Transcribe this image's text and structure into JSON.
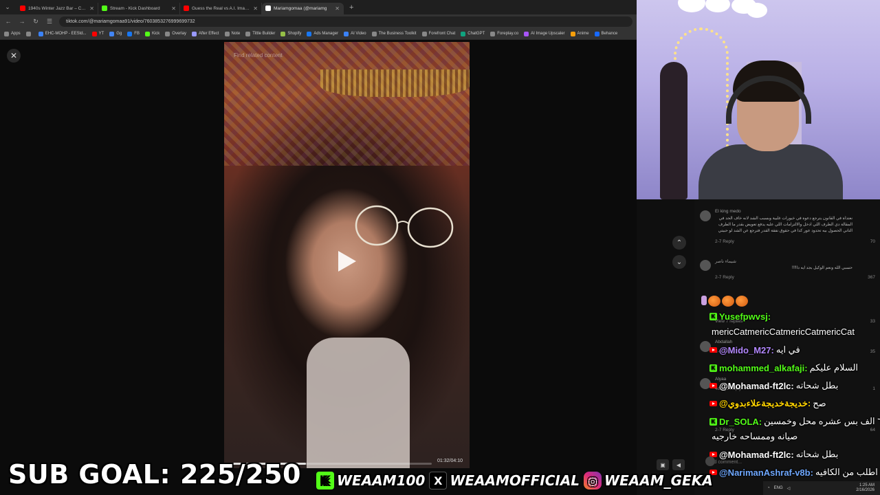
{
  "browser": {
    "tabs": [
      {
        "title": "1940s Winter Jazz Bar – Cozy V",
        "icon": "youtube-icon",
        "color": "#ff0000"
      },
      {
        "title": "Stream - Kick Dashboard",
        "icon": "kick-icon",
        "color": "#53fc18"
      },
      {
        "title": "Guess the Real vs A.I. Image! Fi",
        "icon": "youtube-icon",
        "color": "#ff0000"
      },
      {
        "title": "Mariamgomaa (@mariamg",
        "icon": "tiktok-icon",
        "color": "#ffffff"
      }
    ],
    "new_tab": "+",
    "url": "tiktok.com/@mariamgomaa91/video/7603853276999699732",
    "bookmarks": [
      {
        "label": "Apps",
        "color": "#888888"
      },
      {
        "label": "",
        "color": "#888888"
      },
      {
        "label": "EHC-MOHP - EEStd...",
        "color": "#3b82f6"
      },
      {
        "label": "YT",
        "color": "#ff0000"
      },
      {
        "label": "Gg",
        "color": "#4285f4"
      },
      {
        "label": "FB",
        "color": "#1877f2"
      },
      {
        "label": "Kick",
        "color": "#53fc18"
      },
      {
        "label": "Overlay",
        "color": "#888888"
      },
      {
        "label": "After Effect",
        "color": "#9999ff"
      },
      {
        "label": "Note",
        "color": "#888888"
      },
      {
        "label": "Tittle Builder",
        "color": "#888888"
      },
      {
        "label": "Shopify",
        "color": "#95bf47"
      },
      {
        "label": "Ads Manager",
        "color": "#1877f2"
      },
      {
        "label": "AI Video",
        "color": "#3b82f6"
      },
      {
        "label": "The Business Toolkit",
        "color": "#888888"
      },
      {
        "label": "Forefront Chat",
        "color": "#888888"
      },
      {
        "label": "ChatGPT",
        "color": "#10a37f"
      },
      {
        "label": "Foreplay.co",
        "color": "#888888"
      },
      {
        "label": "AI Image Upscaler",
        "color": "#a855f7"
      },
      {
        "label": "Anime",
        "color": "#f59e0b"
      },
      {
        "label": "Behance",
        "color": "#1769ff"
      }
    ]
  },
  "video": {
    "search_hint": "Find related content",
    "timecode": "01:32/04:10",
    "progress": 0.37
  },
  "comments": [
    {
      "user": "El king medo",
      "text": "نعتذاة في القانون يترجع دعوة في خيورات غلبية وبسبب الشد لانه خاف الحد في المقالة دي الطرف اللي ادخل والالتزامات اللي عليه يدفع تعويض بقدر ما الطرف التاني الحصول بيه تحدود عور كدا في حقوق نفقة القدر فترجع عن الشد لو حبيتي",
      "meta": "2-7  Reply",
      "likes": "70"
    },
    {
      "user": "شيماء ناصر",
      "text": "حسبي الله ونعم الوكيل بجد ايه دا!!!!",
      "meta": "2-7  Reply",
      "likes": "367"
    },
    {
      "user": "",
      "text": "",
      "meta": "View 7 replies",
      "likes": "33"
    },
    {
      "user": "Abdallah",
      "text": "",
      "meta": "2-6  Reply",
      "likes": "35"
    },
    {
      "user": "Alyaa",
      "text": "",
      "meta": "4d ago  Reply",
      "likes": "1"
    },
    {
      "user": "",
      "text": "",
      "meta": "2-7  Reply",
      "likes": "64"
    }
  ],
  "comment_input_placeholder": "Add comment...",
  "chat": [
    {
      "platform": "kick",
      "user": "Yusefpwvsj:",
      "user_color": "#53fc18",
      "message": ""
    },
    {
      "platform": "none",
      "user": "",
      "user_color": "#ffffff",
      "message": "mericCatmericCatmericCatmericCat"
    },
    {
      "platform": "youtube",
      "user": "@Mido_M27:",
      "user_color": "#b388ff",
      "message": "في ايه"
    },
    {
      "platform": "kick",
      "user": "mohammed_alkafaji:",
      "user_color": "#53fc18",
      "message": "السلام عليكم"
    },
    {
      "platform": "youtube",
      "user": "@Mohamad-ft2lc:",
      "user_color": "#ffffff",
      "message": "بطل شحاته"
    },
    {
      "platform": "youtube",
      "user": "@خديجةخديجةعلاءبدوي:",
      "user_color": "#ffd400",
      "message": "صح"
    },
    {
      "platform": "kick",
      "user": "Dr_SOLA:",
      "user_color": "#53fc18",
      "message": "٦٠ الف بس عشره محل وخمسين"
    },
    {
      "platform": "none",
      "user": "",
      "user_color": "#ffffff",
      "message": "صيانه وممساحه خارجيه"
    },
    {
      "platform": "youtube",
      "user": "@Mohamad-ft2lc:",
      "user_color": "#ffffff",
      "message": "بطل شحاته"
    },
    {
      "platform": "youtube",
      "user": "@NarimanAshraf-v8b:",
      "user_color": "#6fa8ff",
      "message": "اطلب من الكافيه"
    }
  ],
  "overlay": {
    "subgoal": "SUB GOAL: 225/250",
    "socials": [
      {
        "icon": "kick-logo-icon",
        "glyph": "K",
        "handle": "WEAAM100"
      },
      {
        "icon": "x-logo-icon",
        "glyph": "X",
        "handle": "WEAAMOFFICIAL"
      },
      {
        "icon": "instagram-logo-icon",
        "glyph": "◎",
        "handle": "WEAAM_GEKA"
      }
    ]
  },
  "tray": {
    "lang": "ENG",
    "time": "1:25 AM",
    "date": "2/16/2026"
  },
  "controls": {
    "close": "✕",
    "up": "⌃",
    "down": "⌄"
  }
}
